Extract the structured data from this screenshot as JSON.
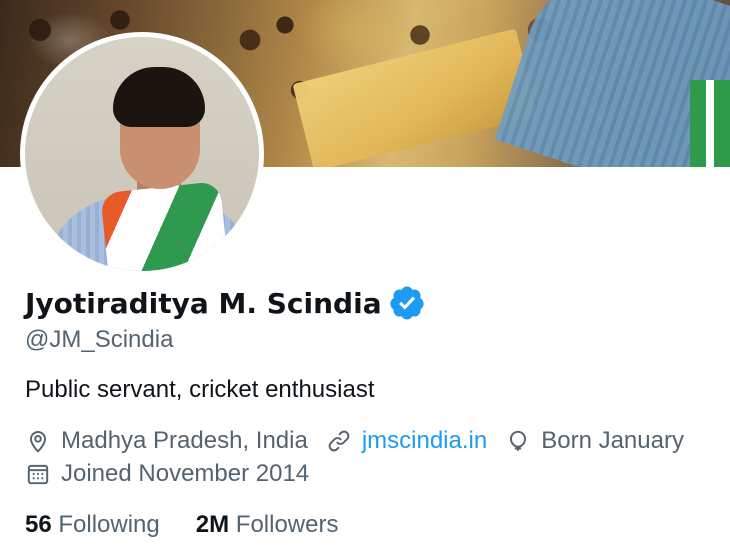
{
  "profile": {
    "display_name": "Jyotiraditya M. Scindia",
    "handle": "@JM_Scindia",
    "bio": "Public servant, cricket enthusiast",
    "location": "Madhya Pradesh, India",
    "website": "jmscindia.in",
    "born": "Born January",
    "joined": "Joined November 2014",
    "verified": true
  },
  "stats": {
    "following_count": "56",
    "following_label": "Following",
    "followers_count": "2M",
    "followers_label": "Followers"
  },
  "icons": {
    "verified": "verified-badge-icon",
    "location": "location-pin-icon",
    "link": "link-icon",
    "birthday": "balloon-icon",
    "joined": "calendar-icon"
  },
  "colors": {
    "accent": "#1d9bf0",
    "text_primary": "#0f1419",
    "text_secondary": "#536471"
  }
}
